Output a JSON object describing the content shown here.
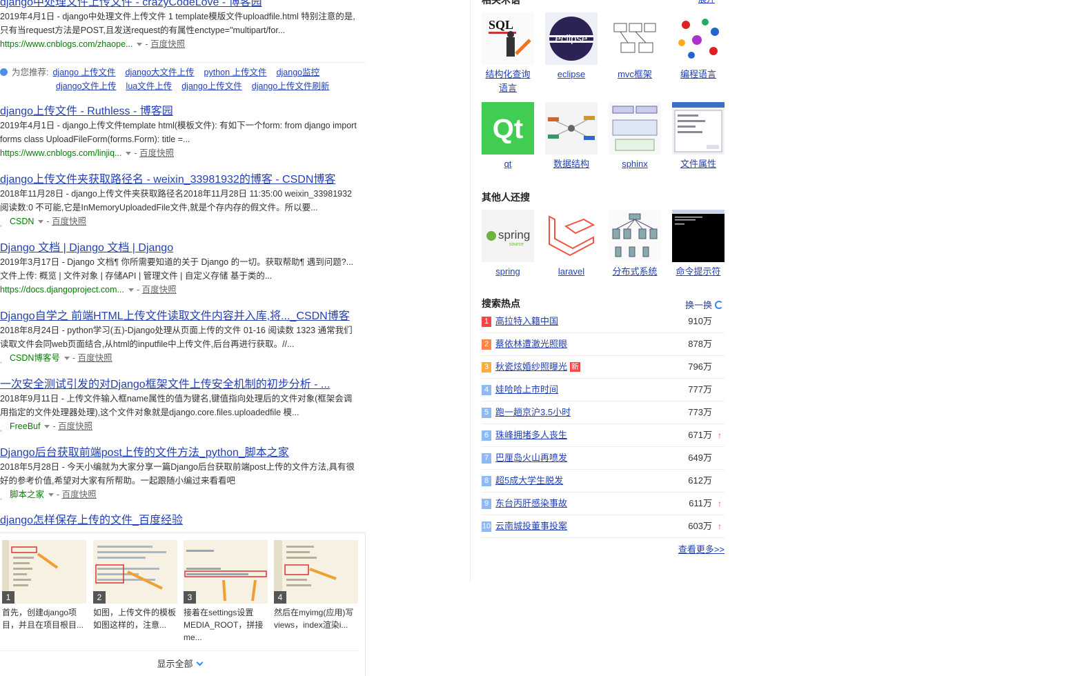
{
  "results": [
    {
      "title": "django中处理文件上传文件 - crazyCodeLove - 博客园",
      "abs1": "2019年4月1日 - django中处理文件上传文件 1 template模版文件uploadfile.html 特别注意的是,",
      "abs2": "只有当request方法是POST,且发送request的有属性enctype=\"multipart/for...",
      "source": "https://www.cnblogs.com/zhaope...",
      "cache": "百度快照"
    },
    {
      "title": "django上传文件 - Ruthless - 博客园",
      "abs1": "2019年4月1日 - django上传文件template html(模板文件): 有如下一个form: from django import",
      "abs2": "forms class UploadFileForm(forms.Form): title =...",
      "source": "https://www.cnblogs.com/linjiq...",
      "cache": "百度快照"
    },
    {
      "title": "django上传文件夹获取路径名 - weixin_33981932的博客 - CSDN博客",
      "abs1": "2018年11月28日 - django上传文件夹获取路径名2018年11月28日 11:35:00 weixin_33981932",
      "abs2": "阅读数:0 不可能,它是InMemoryUploadedFile文件,就是个存内存的假文件。所以要...",
      "source": "CSDN",
      "cache": "百度快照"
    },
    {
      "title": "Django 文档 | Django 文档 | Django",
      "abs1": "2019年3月17日 - Django 文档¶ 你所需要知道的关于 Django 的一切。获取帮助¶ 遇到问题?...",
      "abs2": "文件上传: 概览 | 文件对象 | 存储API | 管理文件 | 自定义存储 基于类的...",
      "source": "https://docs.djangoproject.com...",
      "cache": "百度快照"
    },
    {
      "title": "Django自学之 前端HTML上传文件读取文件内容并入库,将..._CSDN博客",
      "abs1": "2018年8月24日 - python学习(五)-Django处理从页面上传的文件 01-16 阅读数 1323 通常我们",
      "abs2": "读取文件会同web页面结合,从html的inputfile中上传文件,后台再进行获取。//...",
      "source": "CSDN博客号",
      "cache": "百度快照"
    },
    {
      "title": "一次安全测试引发的对Django框架文件上传安全机制的初步分析 - ...",
      "abs1": "2018年9月11日 - 上传文件输入框name属性的值为键名,键值指向处理后的文件对象(框架会调",
      "abs2": "用指定的文件处理器处理),这个文件对象就是django.core.files.uploadedfile 模...",
      "source": "FreeBuf",
      "cache": "百度快照"
    },
    {
      "title": "Django后台获取前端post上传的文件方法_python_脚本之家",
      "abs1": "2018年5月28日 - 今天小编就为大家分享一篇Django后台获取前端post上传的文件方法,具有很",
      "abs2": "好的参考价值,希望对大家有所帮助。一起跟随小编过来看看吧",
      "source": "脚本之家",
      "cache": "百度快照"
    }
  ],
  "recommend": {
    "label": "为您推荐:",
    "row1": [
      "django 上传文件",
      "django大文件上传",
      "python 上传文件",
      "django监控"
    ],
    "row2": [
      "django文件上传",
      "lua文件上传",
      "django上传文件",
      "django上传文件刷新"
    ]
  },
  "howto": {
    "title": "django怎样保存上传的文件_百度经验",
    "steps": [
      {
        "num": "1",
        "caption": "首先，创建django项目，并且在项目根目..."
      },
      {
        "num": "2",
        "caption": "如图，上传文件的模板如图这样的，注意..."
      },
      {
        "num": "3",
        "caption": "接着在settings设置MEDIA_ROOT，拼接me..."
      },
      {
        "num": "4",
        "caption": "然后在myimg(应用)写views，index渲染i..."
      }
    ],
    "show_all": "显示全部"
  },
  "right": {
    "related_title": "相关术语",
    "related_more": "展开",
    "related": [
      {
        "label": "结构化查询语言",
        "icon": "sql-book-icon"
      },
      {
        "label": "eclipse",
        "icon": "eclipse-logo-icon"
      },
      {
        "label": "mvc框架",
        "icon": "mvc-diagram-icon"
      },
      {
        "label": "编程语言",
        "icon": "language-logos-icon"
      },
      {
        "label": "qt",
        "icon": "qt-logo-icon"
      },
      {
        "label": "数据结构",
        "icon": "mindmap-icon"
      },
      {
        "label": "sphinx",
        "icon": "sphinx-diagram-icon"
      },
      {
        "label": "文件属性",
        "icon": "dialog-screenshot-icon"
      }
    ],
    "others_title": "其他人还搜",
    "others": [
      {
        "label": "spring",
        "icon": "spring-logo-icon"
      },
      {
        "label": "laravel",
        "icon": "laravel-logo-icon"
      },
      {
        "label": "分布式系统",
        "icon": "network-diagram-icon"
      },
      {
        "label": "命令提示符",
        "icon": "terminal-icon"
      }
    ],
    "hot_title": "搜索热点",
    "refresh": "换一换",
    "hot": [
      {
        "rank": "1",
        "name": "高拉特入籍中国",
        "count": "910万",
        "tag": "",
        "up": false
      },
      {
        "rank": "2",
        "name": "蔡依林遭激光照眼",
        "count": "878万",
        "tag": "",
        "up": false
      },
      {
        "rank": "3",
        "name": "秋瓷炫婚纱照曝光",
        "count": "796万",
        "tag": "新",
        "up": false
      },
      {
        "rank": "4",
        "name": "娃哈哈上市时间",
        "count": "777万",
        "tag": "",
        "up": false
      },
      {
        "rank": "5",
        "name": "跑一趟京沪3.5小时",
        "count": "773万",
        "tag": "",
        "up": false
      },
      {
        "rank": "6",
        "name": "珠峰拥堵多人丧生",
        "count": "671万",
        "tag": "",
        "up": true
      },
      {
        "rank": "7",
        "name": "巴厘岛火山再喷发",
        "count": "649万",
        "tag": "",
        "up": false
      },
      {
        "rank": "8",
        "name": "超5成大学生脱发",
        "count": "612万",
        "tag": "",
        "up": false
      },
      {
        "rank": "9",
        "name": "东台丙肝感染事故",
        "count": "611万",
        "tag": "",
        "up": true
      },
      {
        "rank": "10",
        "name": "云南城投董事投案",
        "count": "603万",
        "tag": "",
        "up": true
      }
    ],
    "up_arrow": "↑",
    "more": "查看更多>>"
  },
  "colors": {
    "link": "#2440b3",
    "highlight": "#cc0000",
    "source": "#008000",
    "hot1": "#f54545",
    "hot2": "#ff8547",
    "hot3": "#ffac38",
    "hotN": "#8eb9f5"
  }
}
